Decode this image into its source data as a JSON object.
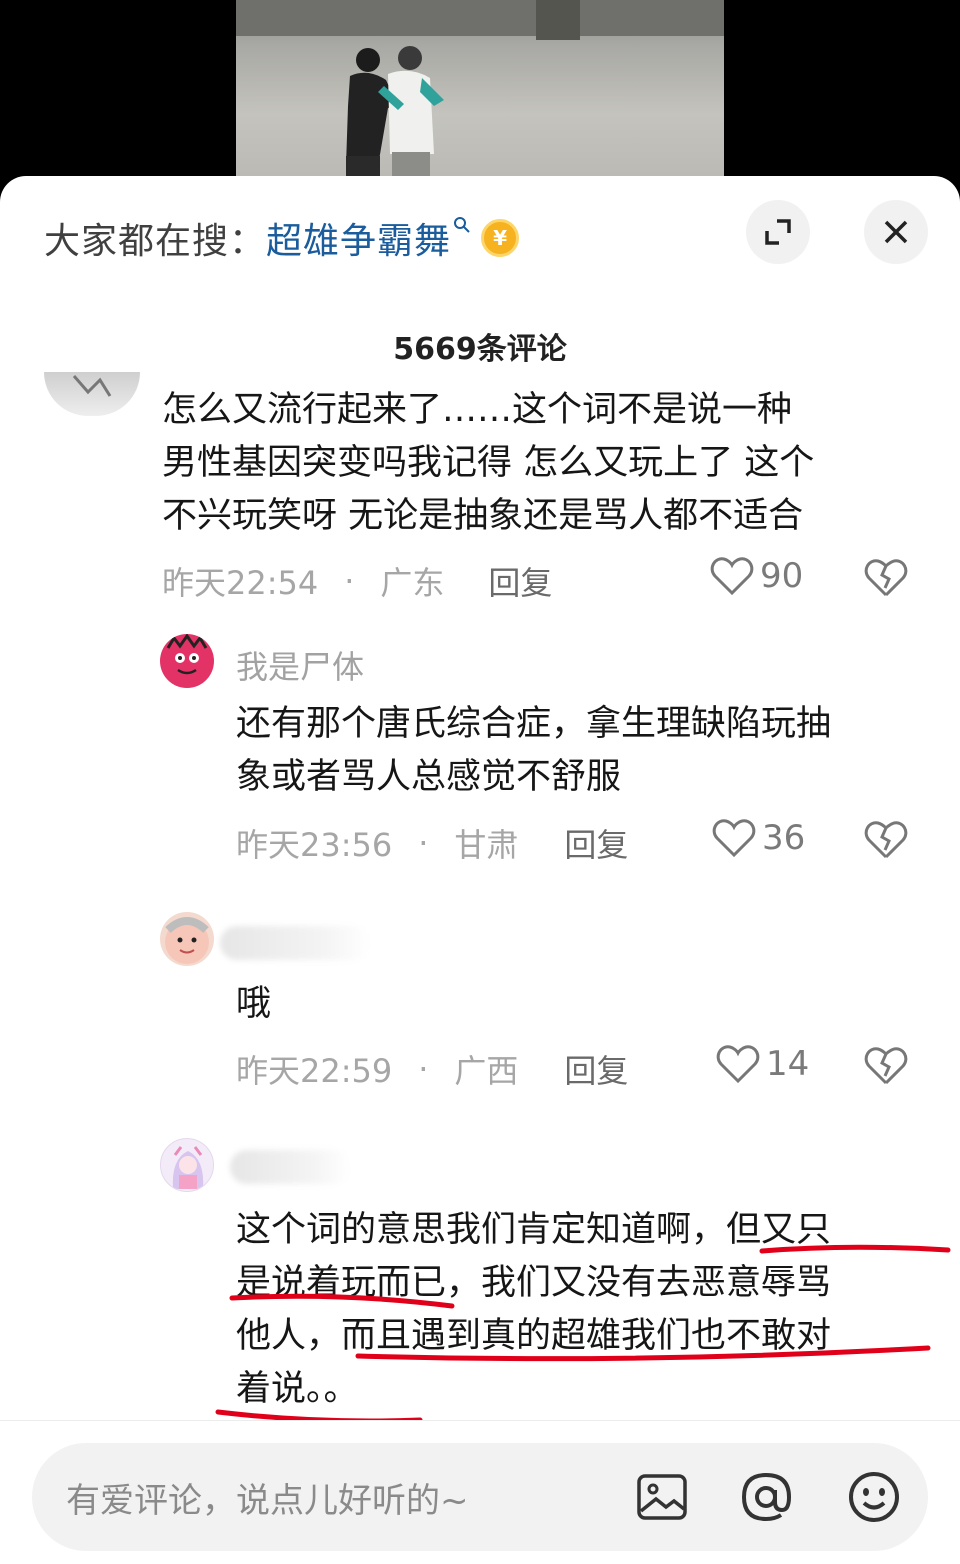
{
  "search": {
    "prefix": "大家都在搜：",
    "term": "超雄争霸舞",
    "coin_symbol": "¥"
  },
  "header": {
    "comment_count_title": "5669条评论"
  },
  "comments": [
    {
      "text_lines": [
        "怎么又流行起来了……这个词不是说一种",
        "男性基因突变吗我记得 怎么又玩上了 这个",
        "不兴玩笑呀 无论是抽象还是骂人都不适合"
      ],
      "time": "昨天22:54",
      "region": "广东",
      "reply_label": "回复",
      "likes": "90"
    }
  ],
  "replies": [
    {
      "username": "我是尸体",
      "text_lines": [
        "还有那个唐氏综合症，拿生理缺陷玩抽",
        "象或者骂人总感觉不舒服"
      ],
      "time": "昨天23:56",
      "region": "甘肃",
      "reply_label": "回复",
      "likes": "36"
    },
    {
      "text_lines": [
        "哦"
      ],
      "time": "昨天22:59",
      "region": "广西",
      "reply_label": "回复",
      "likes": "14"
    },
    {
      "text_lines": [
        "这个词的意思我们肯定知道啊，但又只",
        "是说着玩而已，我们又没有去恶意辱骂",
        "他人，而且遇到真的超雄我们也不敢对",
        "着说。。"
      ]
    }
  ],
  "separator_dot": "·",
  "input": {
    "placeholder": "有爱评论，说点儿好听的~"
  },
  "colors": {
    "accent_link": "#1a5c9c",
    "highlight_underline": "#e0001a",
    "coin": "#f7b21f"
  },
  "icons": [
    "expand-icon",
    "close-icon",
    "heart-icon",
    "broken-heart-icon",
    "image-icon",
    "at-icon",
    "emoji-icon",
    "search-icon",
    "coin-icon"
  ]
}
